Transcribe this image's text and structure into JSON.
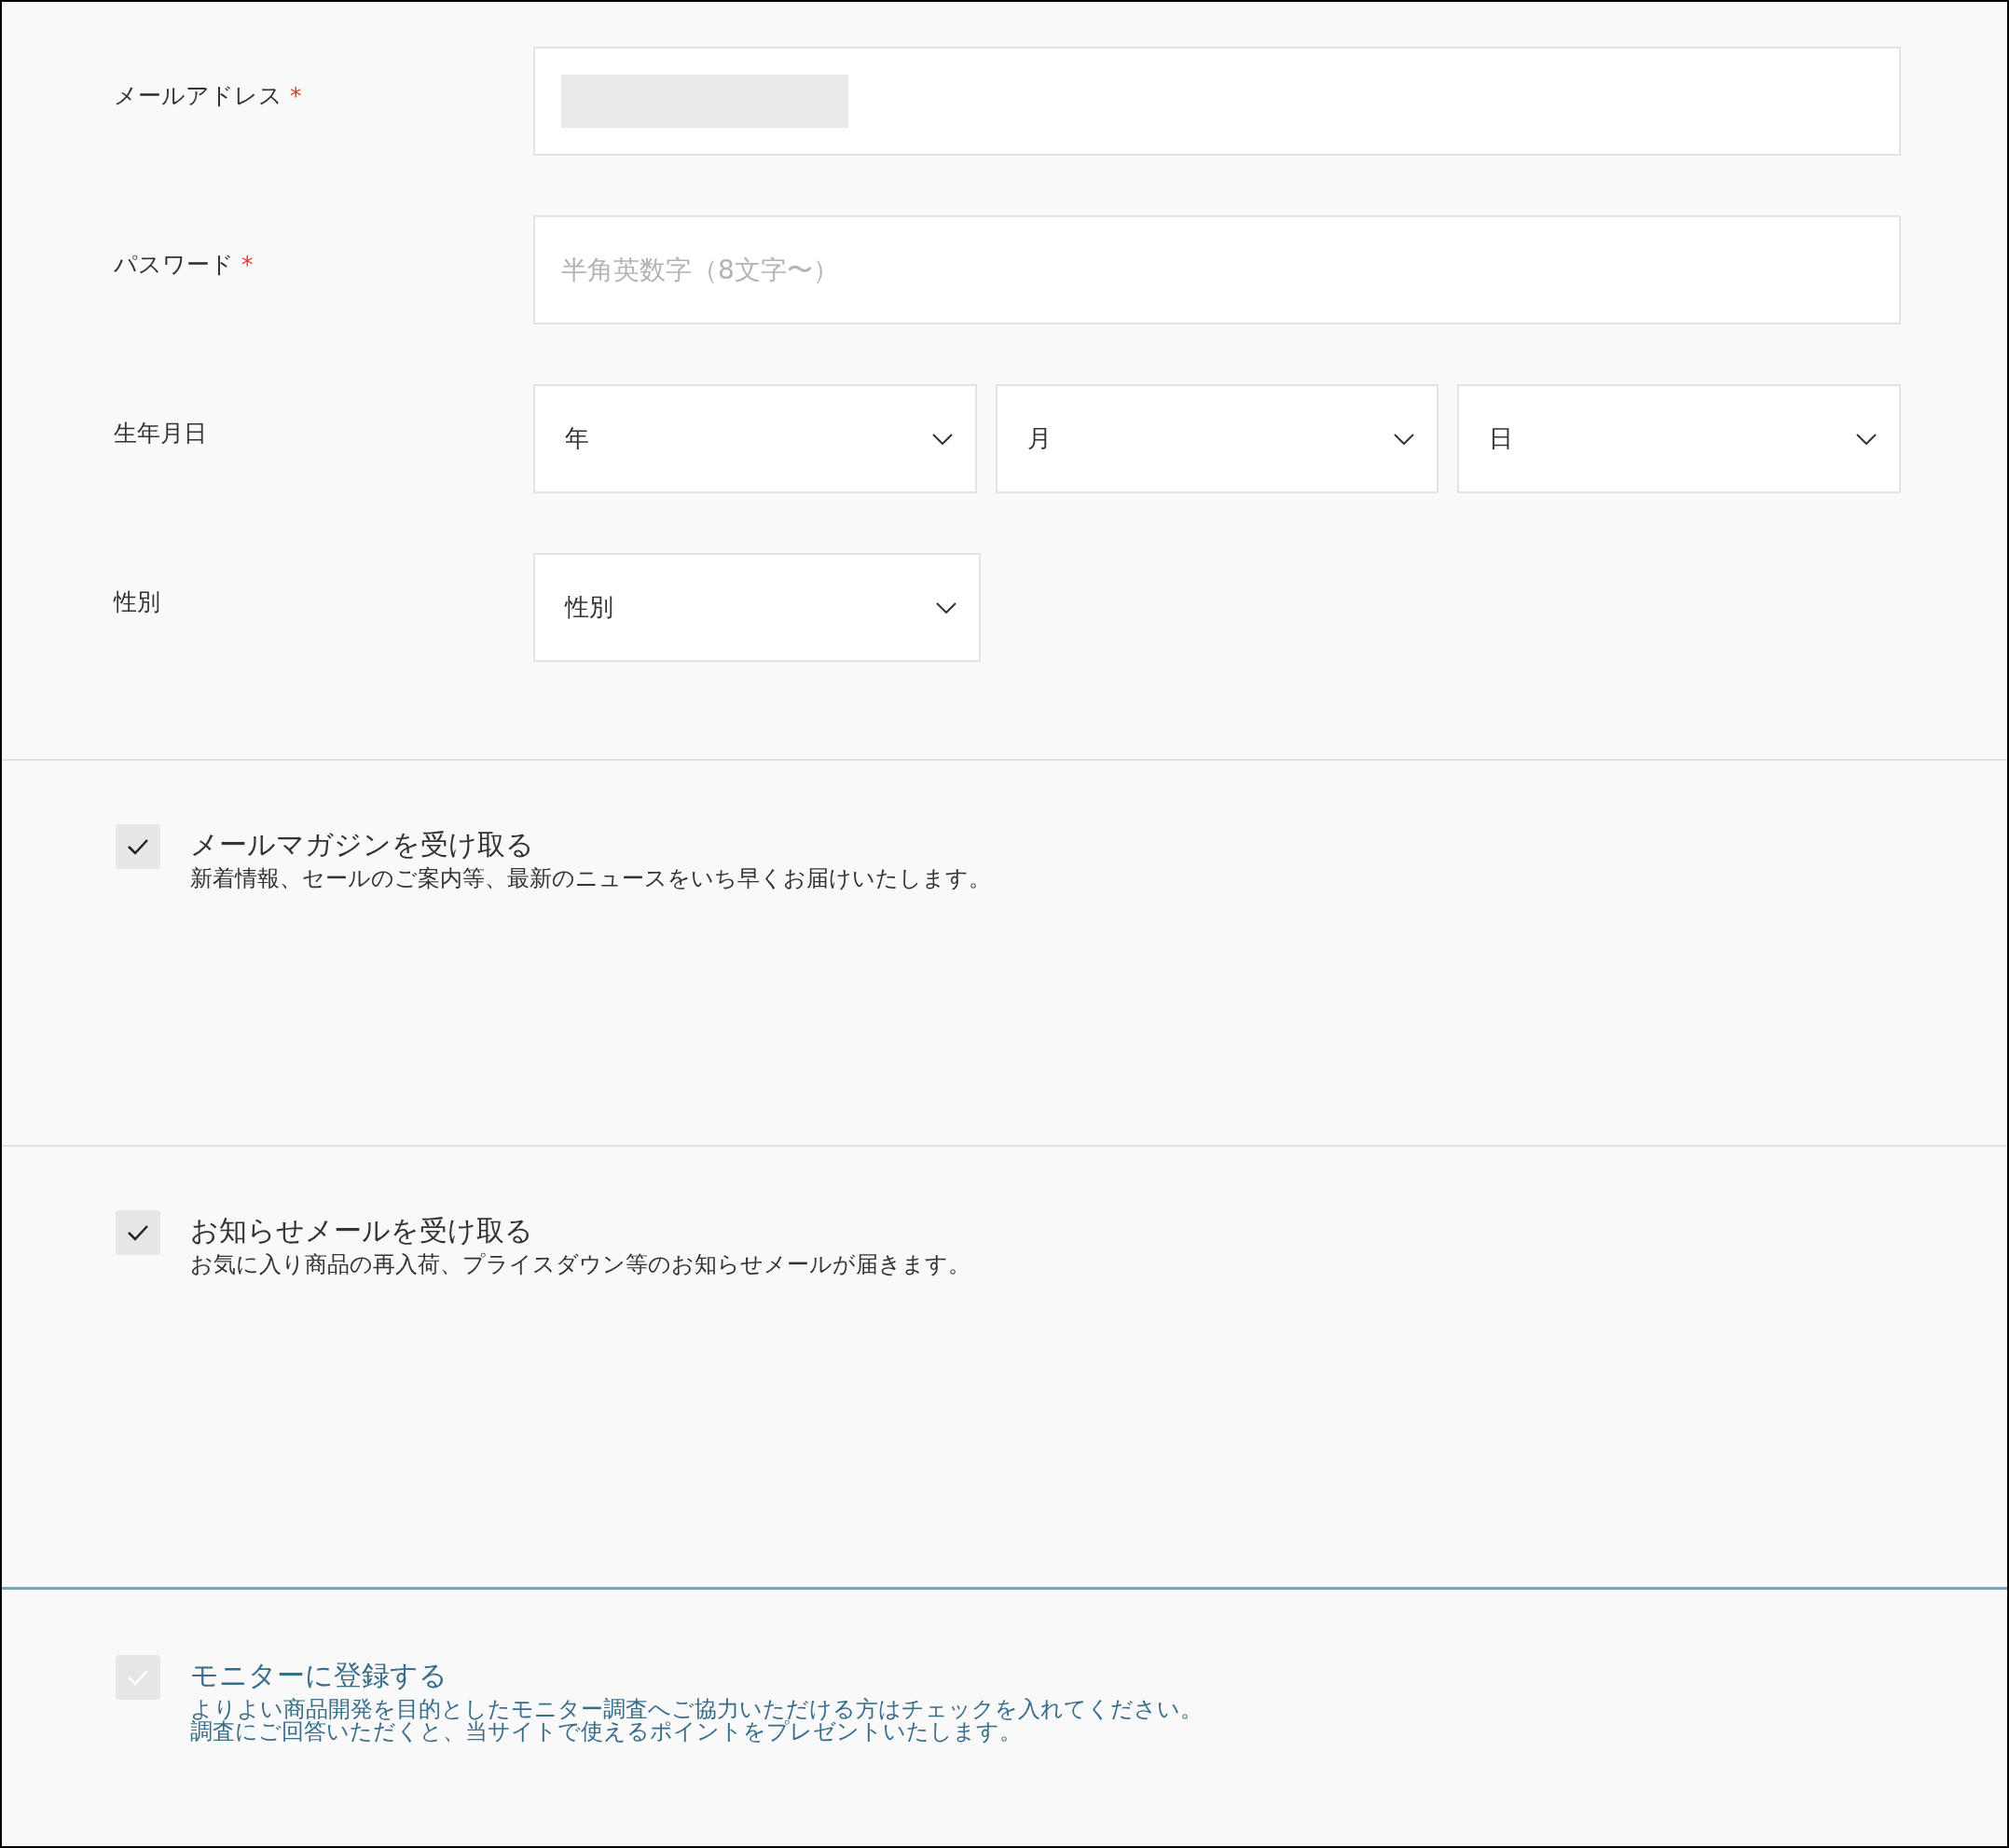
{
  "fields": [
    {
      "label": "メールアドレス",
      "required_mark": "*",
      "redacted": true
    },
    {
      "label": "パスワード",
      "required_mark": "*",
      "placeholder": "半角英数字（8文字〜）"
    }
  ],
  "birthday": {
    "label": "生年月日",
    "selects": [
      {
        "value": "年"
      },
      {
        "value": "月"
      },
      {
        "value": "日"
      }
    ]
  },
  "gender": {
    "label": "性別",
    "select": {
      "value": "性別"
    }
  },
  "options": [
    {
      "title": "メールマガジンを受け取る",
      "description": [
        "新着情報、セールのご案内等、最新のニュースをいち早くお届けいたします。"
      ],
      "checked": true,
      "kind": "plain"
    },
    {
      "title": "お知らせメールを受け取る",
      "description": [
        "お気に入り商品の再入荷、プライスダウン等のお知らせメールが届きます。"
      ],
      "checked": true,
      "kind": "plain"
    },
    {
      "title": "モニターに登録する",
      "description": [
        "よりよい商品開発を目的としたモニター調査へご協力いただける方はチェックを入れてください。",
        "調査にご回答いただくと、当サイトで使えるポイントをプレゼントいたします。"
      ],
      "checked": false,
      "kind": "highlight"
    }
  ]
}
